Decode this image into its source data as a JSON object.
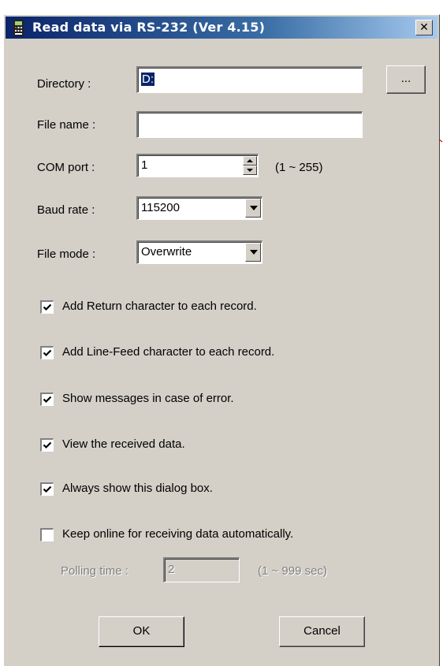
{
  "window": {
    "title": "Read data via RS-232 (Ver 4.15)"
  },
  "directory": {
    "label": "Directory :",
    "value": "D:",
    "browse_label": "..."
  },
  "file_name": {
    "label": "File name :",
    "value": ""
  },
  "com_port": {
    "label": "COM port :",
    "value": "1",
    "range": "(1 ~ 255)"
  },
  "baud_rate": {
    "label": "Baud rate :",
    "value": "115200"
  },
  "file_mode": {
    "label": "File mode :",
    "value": "Overwrite"
  },
  "options": [
    {
      "label": "Add Return character to each record.",
      "checked": true
    },
    {
      "label": "Add Line-Feed character to each record.",
      "checked": true
    },
    {
      "label": "Show messages in case of error.",
      "checked": true
    },
    {
      "label": "View the received data.",
      "checked": true
    },
    {
      "label": "Always show this dialog box.",
      "checked": true
    },
    {
      "label": "Keep online for receiving data automatically.",
      "checked": false
    }
  ],
  "polling": {
    "label": "Polling time :",
    "value": "2",
    "range": "(1 ~ 999 sec)"
  },
  "buttons": {
    "ok": "OK",
    "cancel": "Cancel"
  },
  "colors": {
    "titlebar": "#0a246a",
    "face": "#d4d0c8",
    "annotation_line": "#ff0000"
  }
}
